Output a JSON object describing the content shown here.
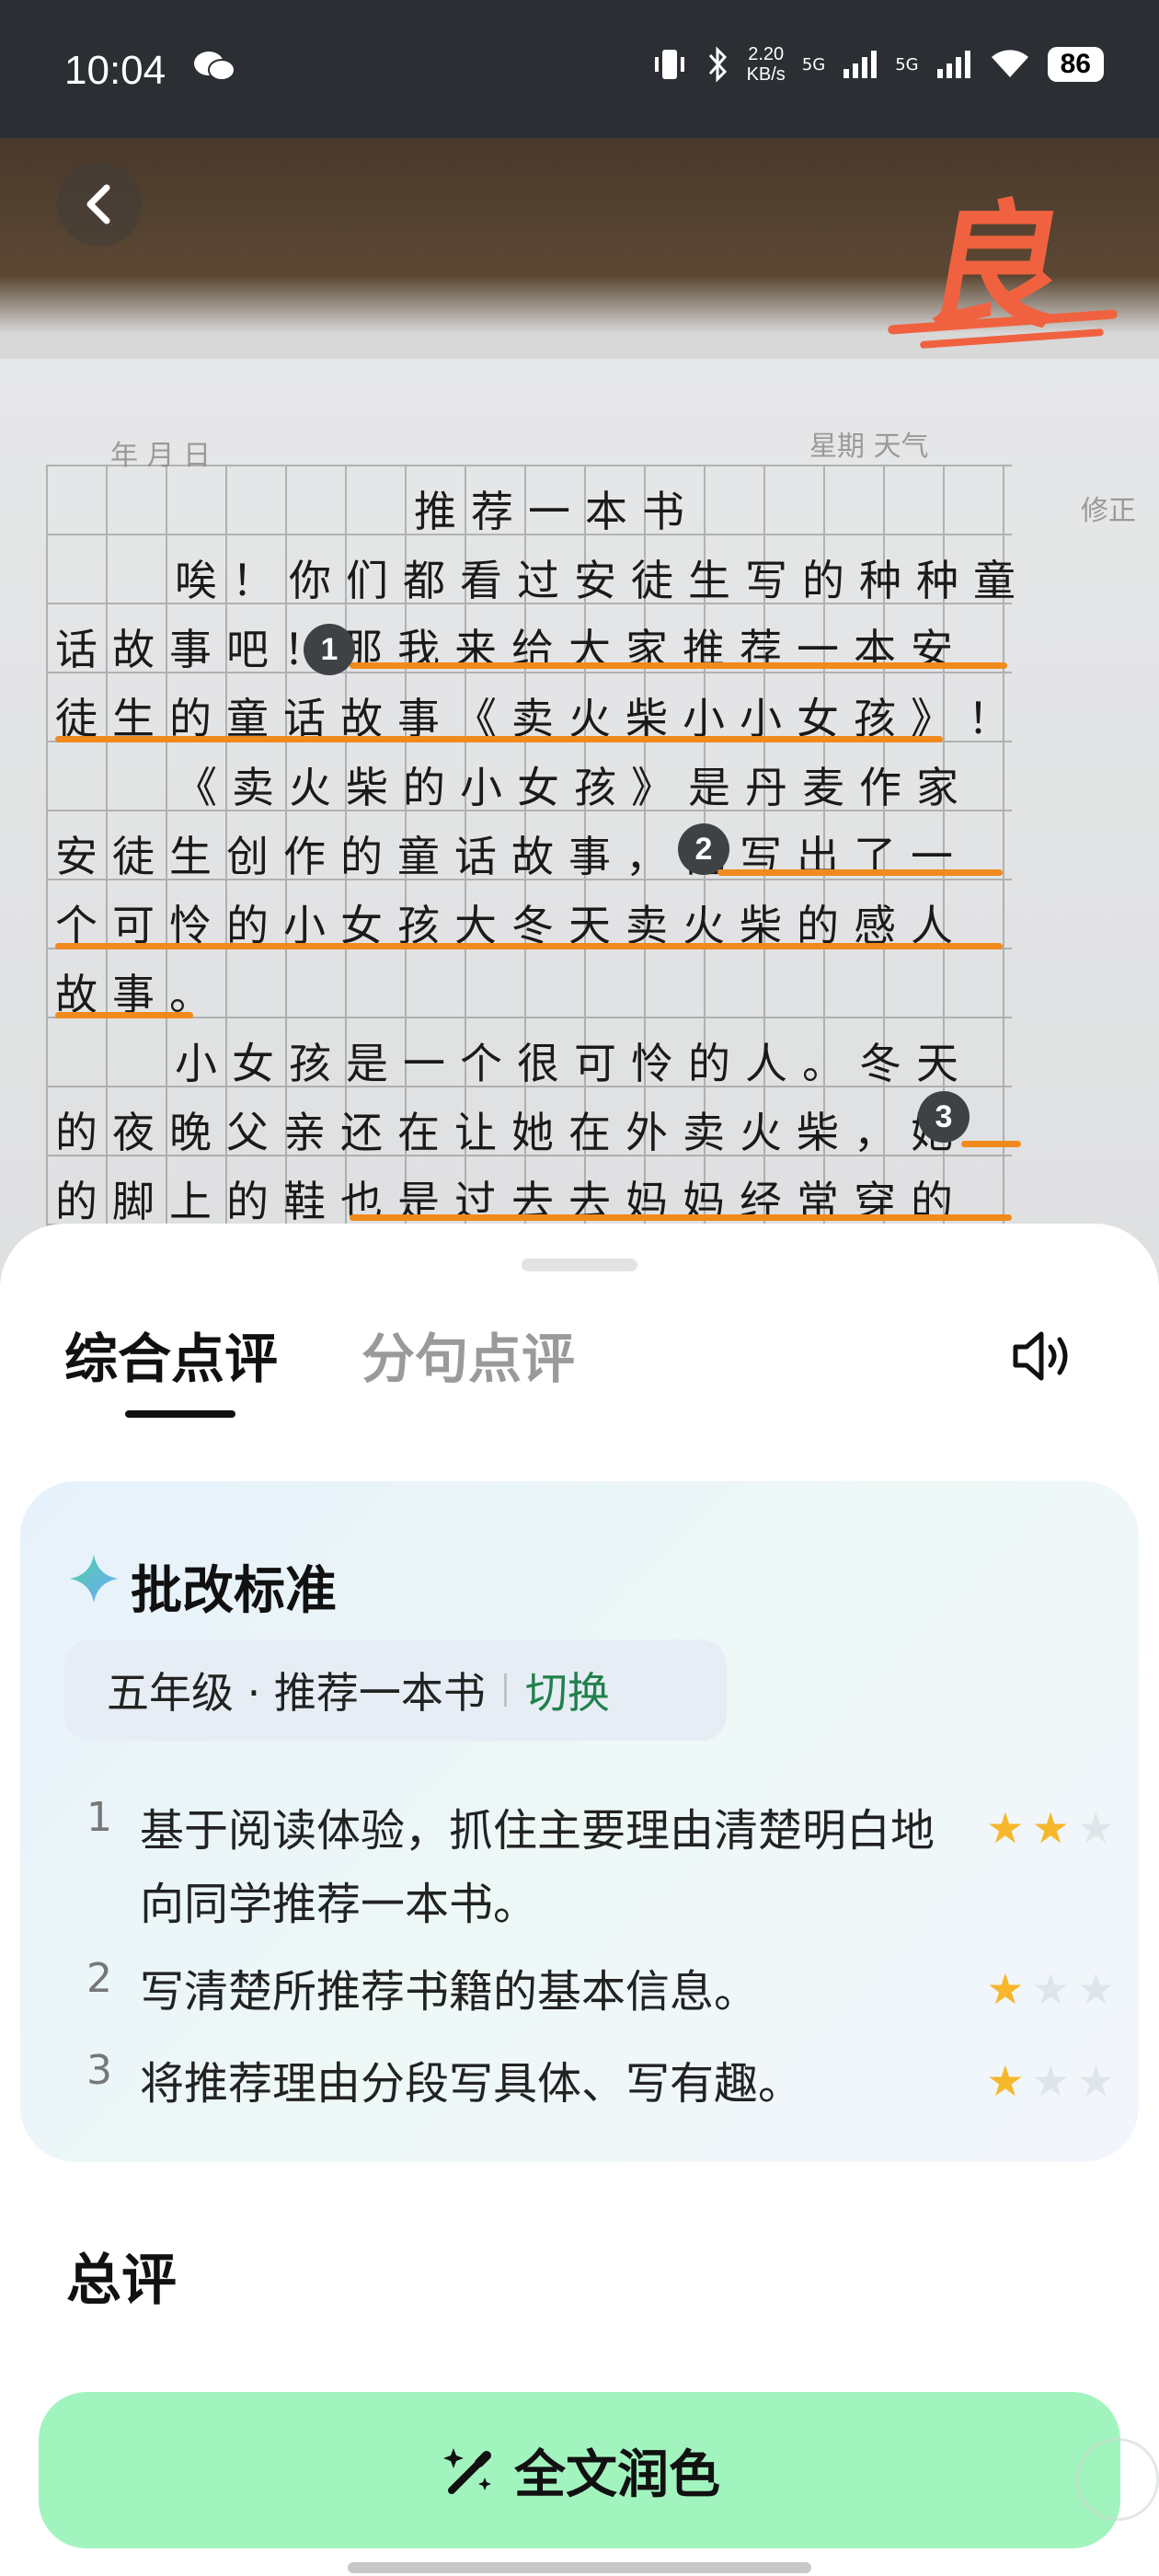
{
  "status_bar": {
    "time": "10:04",
    "net_speed_value": "2.20",
    "net_speed_unit": "KB/s",
    "signal_1": "5G",
    "signal_2": "5G",
    "battery": "86"
  },
  "photo": {
    "grade": "良",
    "header_left": "年  月  日",
    "header_right": "星期 天气",
    "margin_note": "修正",
    "lines": [
      "推荐一本书",
      "唉！你们都看过安徒生写的种种童",
      "话故事吧！那我来给大家推荐一本安",
      "徒生的童话故事《卖火柴小小女孩》！",
      "《卖火柴的小女孩》是丹麦作家",
      "安徒生创作的童话故事，他写出了一",
      "个可怜的小女孩大冬天卖火柴的感人",
      "故事。",
      "小女孩是一个很可怜的人。冬天",
      "的夜晚父亲还在让她在外卖火柴，她",
      "的脚上的鞋也是过去去妈妈经常穿的"
    ],
    "markers": [
      "1",
      "2",
      "3"
    ]
  },
  "sheet": {
    "tabs": [
      "综合点评",
      "分句点评"
    ],
    "card": {
      "title": "批改标准",
      "grade_info": "五年级 · 推荐一本书",
      "switch_label": "切换",
      "criteria": [
        {
          "num": "1",
          "text": "基于阅读体验，抓住主要理由清楚明白地向同学推荐一本书。",
          "stars": 2
        },
        {
          "num": "2",
          "text": "写清楚所推荐书籍的基本信息。",
          "stars": 1
        },
        {
          "num": "3",
          "text": "将推荐理由分段写具体、写有趣。",
          "stars": 1
        }
      ],
      "max_stars": 3
    },
    "summary_title": "总评",
    "polish_button": "全文润色"
  },
  "colors": {
    "accent_orange": "#f08a1c",
    "grade_red": "#f0623f",
    "button_green": "#a2f4bf",
    "switch_green": "#21804d",
    "star_gold": "#f7b72b"
  }
}
